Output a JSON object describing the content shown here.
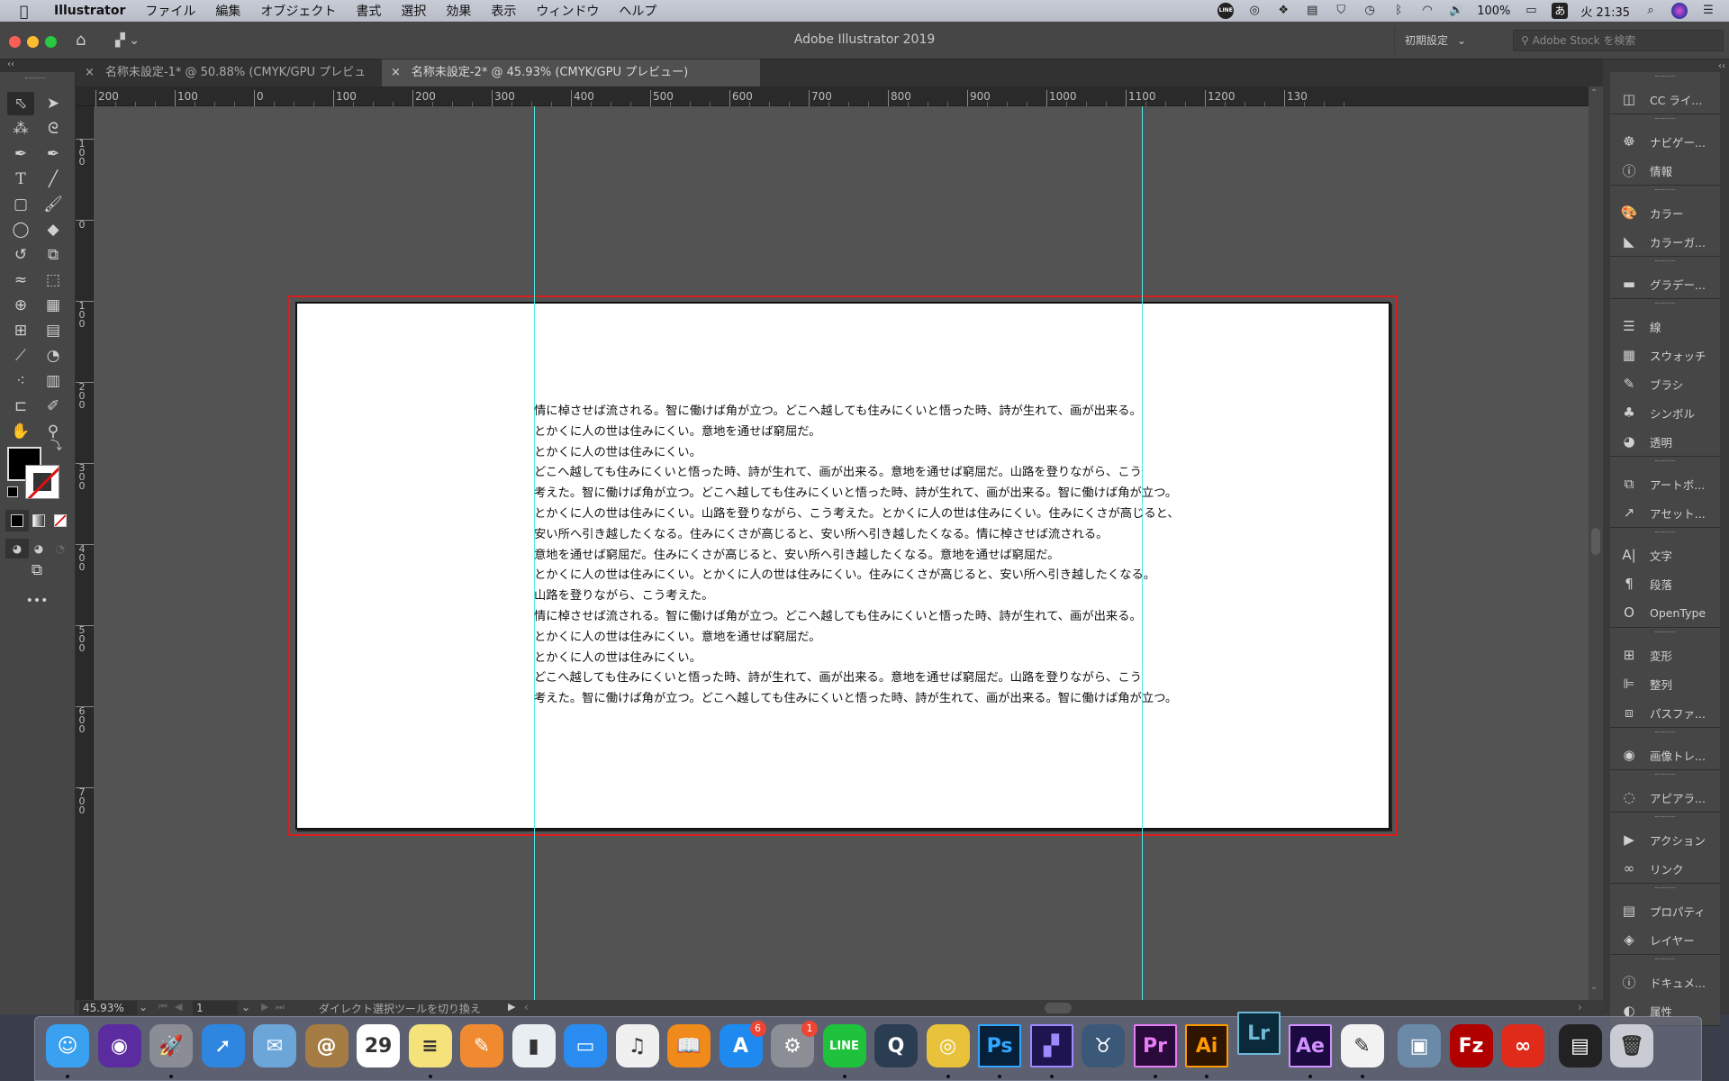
{
  "menubar": {
    "app_name": "Illustrator",
    "items": [
      "ファイル",
      "編集",
      "オブジェクト",
      "書式",
      "選択",
      "効果",
      "表示",
      "ウィンドウ",
      "ヘルプ"
    ],
    "status": {
      "battery": "100%",
      "ime": "あ",
      "clock": "火 21:35",
      "line_icon": "LINE"
    }
  },
  "window": {
    "title": "Adobe Illustrator 2019",
    "workspace": "初期設定",
    "stock_search_placeholder": "Adobe Stock を検索"
  },
  "tabs": [
    {
      "label": "名称未設定-1* @ 50.88% (CMYK/GPU プレビュー)",
      "active": false
    },
    {
      "label": "名称未設定-2* @ 45.93% (CMYK/GPU プレビュー)",
      "active": true
    }
  ],
  "ruler": {
    "horizontal": [
      "200",
      "100",
      "0",
      "100",
      "200",
      "300",
      "400",
      "500",
      "600",
      "700",
      "800",
      "900",
      "1000",
      "1100",
      "1200",
      "130"
    ],
    "vertical": [
      "100",
      "0",
      "100",
      "200",
      "300",
      "400",
      "500",
      "600",
      "700"
    ]
  },
  "document": {
    "lines": [
      "情に棹させば流される。智に働けば角が立つ。どこへ越しても住みにくいと悟った時、詩が生れて、画が出来る。",
      "とかくに人の世は住みにくい。意地を通せば窮屈だ。",
      "とかくに人の世は住みにくい。",
      "どこへ越しても住みにくいと悟った時、詩が生れて、画が出来る。意地を通せば窮屈だ。山路を登りながら、こう",
      "考えた。智に働けば角が立つ。どこへ越しても住みにくいと悟った時、詩が生れて、画が出来る。智に働けば角が立つ。",
      "とかくに人の世は住みにくい。山路を登りながら、こう考えた。とかくに人の世は住みにくい。住みにくさが高じると、",
      "安い所へ引き越したくなる。住みにくさが高じると、安い所へ引き越したくなる。情に棹させば流される。",
      "意地を通せば窮屈だ。住みにくさが高じると、安い所へ引き越したくなる。意地を通せば窮屈だ。",
      "とかくに人の世は住みにくい。とかくに人の世は住みにくい。住みにくさが高じると、安い所へ引き越したくなる。",
      "山路を登りながら、こう考えた。",
      "情に棹させば流される。智に働けば角が立つ。どこへ越しても住みにくいと悟った時、詩が生れて、画が出来る。",
      "とかくに人の世は住みにくい。意地を通せば窮屈だ。",
      "とかくに人の世は住みにくい。",
      "どこへ越しても住みにくいと悟った時、詩が生れて、画が出来る。意地を通せば窮屈だ。山路を登りながら、こう",
      "考えた。智に働けば角が立つ。どこへ越しても住みにくいと悟った時、詩が生れて、画が出来る。智に働けば角が立つ。"
    ]
  },
  "statusbar": {
    "zoom": "45.93%",
    "artboard": "1",
    "status_text": "ダイレクト選択ツールを切り換え"
  },
  "panels": [
    {
      "items": [
        {
          "icon": "cc-libraries-icon",
          "glyph": "◫",
          "label": "CC ライ..."
        }
      ]
    },
    {
      "items": [
        {
          "icon": "navigator-icon",
          "glyph": "☸",
          "label": "ナビゲー..."
        },
        {
          "icon": "info-icon",
          "glyph": "ⓘ",
          "label": "情報"
        }
      ]
    },
    {
      "items": [
        {
          "icon": "color-icon",
          "glyph": "🎨",
          "label": "カラー"
        },
        {
          "icon": "color-guide-icon",
          "glyph": "◣",
          "label": "カラーガ..."
        }
      ]
    },
    {
      "items": [
        {
          "icon": "gradient-icon",
          "glyph": "▬",
          "label": "グラデー..."
        }
      ]
    },
    {
      "items": [
        {
          "icon": "stroke-icon",
          "glyph": "☰",
          "label": "線"
        },
        {
          "icon": "swatches-icon",
          "glyph": "▦",
          "label": "スウォッチ"
        },
        {
          "icon": "brushes-icon",
          "glyph": "✎",
          "label": "ブラシ"
        },
        {
          "icon": "symbols-icon",
          "glyph": "♣",
          "label": "シンボル"
        },
        {
          "icon": "transparency-icon",
          "glyph": "◕",
          "label": "透明"
        }
      ]
    },
    {
      "items": [
        {
          "icon": "artboards-icon",
          "glyph": "⧉",
          "label": "アートボ..."
        },
        {
          "icon": "asset-export-icon",
          "glyph": "↗",
          "label": "アセット..."
        }
      ]
    },
    {
      "items": [
        {
          "icon": "character-icon",
          "glyph": "A|",
          "label": "文字"
        },
        {
          "icon": "paragraph-icon",
          "glyph": "¶",
          "label": "段落"
        },
        {
          "icon": "opentype-icon",
          "glyph": "O",
          "label": "OpenType"
        }
      ]
    },
    {
      "items": [
        {
          "icon": "transform-icon",
          "glyph": "⊞",
          "label": "変形"
        },
        {
          "icon": "align-icon",
          "glyph": "⊫",
          "label": "整列"
        },
        {
          "icon": "pathfinder-icon",
          "glyph": "⧈",
          "label": "パスファ..."
        }
      ]
    },
    {
      "items": [
        {
          "icon": "image-trace-icon",
          "glyph": "◉",
          "label": "画像トレ..."
        }
      ]
    },
    {
      "items": [
        {
          "icon": "appearance-icon",
          "glyph": "◌",
          "label": "アピアラ..."
        }
      ]
    },
    {
      "items": [
        {
          "icon": "actions-icon",
          "glyph": "▶",
          "label": "アクション"
        },
        {
          "icon": "links-icon",
          "glyph": "∞",
          "label": "リンク"
        }
      ]
    },
    {
      "items": [
        {
          "icon": "properties-icon",
          "glyph": "▤",
          "label": "プロパティ"
        },
        {
          "icon": "layers-icon",
          "glyph": "◈",
          "label": "レイヤー"
        }
      ]
    },
    {
      "items": [
        {
          "icon": "document-info-icon",
          "glyph": "ⓘ",
          "label": "ドキュメ..."
        },
        {
          "icon": "attributes-icon",
          "glyph": "◐",
          "label": "属性"
        }
      ]
    }
  ],
  "dock": [
    {
      "name": "finder",
      "label": "☺",
      "bg": "#3aa0f0",
      "dot": true
    },
    {
      "name": "siri",
      "label": "◉",
      "bg": "#5b2ca0",
      "dot": false
    },
    {
      "name": "launchpad",
      "label": "🚀",
      "bg": "#8a8d94",
      "dot": true
    },
    {
      "name": "safari",
      "label": "➚",
      "bg": "#2f86e0",
      "dot": false
    },
    {
      "name": "mail",
      "label": "✉",
      "bg": "#6ca5d8",
      "dot": false
    },
    {
      "name": "contacts",
      "label": "@",
      "bg": "#a67c45",
      "dot": false
    },
    {
      "name": "calendar",
      "label": "29",
      "bg": "#ffffff",
      "dot": false
    },
    {
      "name": "notes",
      "label": "≡",
      "bg": "#f5e27a",
      "dot": true
    },
    {
      "name": "pages",
      "label": "✎",
      "bg": "#f08a30",
      "dot": false
    },
    {
      "name": "numbers",
      "label": "▮",
      "bg": "#e9eef2",
      "dot": false
    },
    {
      "name": "keynote",
      "label": "▭",
      "bg": "#2a8cf0",
      "dot": false
    },
    {
      "name": "itunes",
      "label": "♫",
      "bg": "#f0f0f0",
      "dot": false
    },
    {
      "name": "ibooks",
      "label": "📖",
      "bg": "#f08a1a",
      "dot": false
    },
    {
      "name": "app-store",
      "label": "A",
      "bg": "#1e8af0",
      "dot": false,
      "badge": "6"
    },
    {
      "name": "system-preferences",
      "label": "⚙",
      "bg": "#8b8e94",
      "dot": false,
      "badge": "1"
    },
    {
      "name": "line",
      "label": "LINE",
      "bg": "#1fc23c",
      "dot": true
    },
    {
      "name": "quicktime",
      "label": "Q",
      "bg": "#2a3d52",
      "dot": false
    },
    {
      "name": "chrome",
      "label": "◎",
      "bg": "#e8c23a",
      "dot": true
    },
    {
      "name": "photoshop",
      "label": "Ps",
      "bg": "#07203a",
      "dot": true
    },
    {
      "name": "media-encoder",
      "label": "▞",
      "bg": "#1e1550",
      "dot": true
    },
    {
      "name": "bull-app",
      "label": "♉",
      "bg": "#3b5878",
      "dot": false
    },
    {
      "name": "premiere",
      "label": "Pr",
      "bg": "#2a0a3a",
      "dot": true
    },
    {
      "name": "illustrator",
      "label": "Ai",
      "bg": "#2f1400",
      "dot": true
    },
    {
      "name": "lightroom",
      "label": "Lr",
      "bg": "#0a2a3a",
      "dot": false
    },
    {
      "name": "after-effects",
      "label": "Ae",
      "bg": "#1a0a40",
      "dot": true
    },
    {
      "name": "textedit",
      "label": "✎",
      "bg": "#f2f2f2",
      "dot": true
    },
    {
      "name": "preview",
      "label": "▣",
      "bg": "#6a8aa8",
      "dot": false
    },
    {
      "name": "filezilla",
      "label": "Fz",
      "bg": "#b00000",
      "dot": false
    },
    {
      "name": "creative-cloud",
      "label": "∞",
      "bg": "#e02a1a",
      "dot": false
    },
    {
      "name": "screenshot-stack",
      "label": "▤",
      "bg": "#222222",
      "dot": false
    },
    {
      "name": "trash",
      "label": "🗑",
      "bg": "#c9ccd2",
      "dot": false
    }
  ],
  "colors": {
    "bleed": "#d81e1e",
    "guide": "#4fe8e8",
    "accent_red": "#ee4433"
  }
}
